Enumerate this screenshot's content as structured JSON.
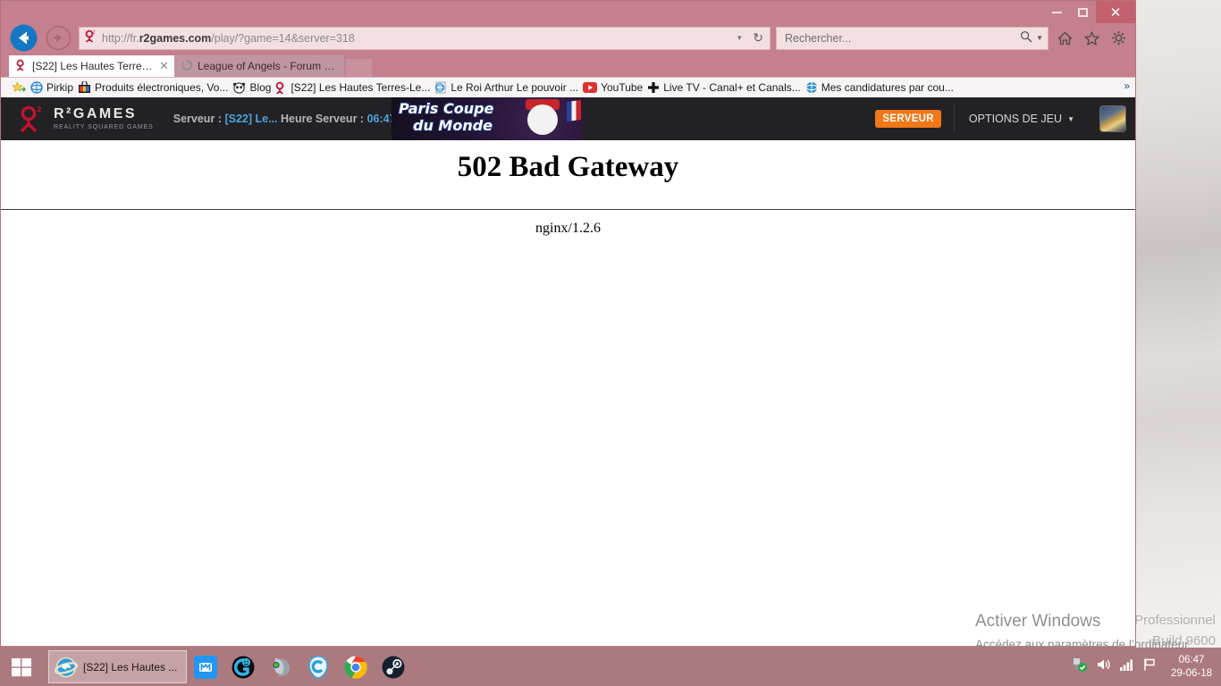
{
  "desktop": {
    "watermark_line1": "Professionnel",
    "watermark_line2": "Build 9600"
  },
  "browser": {
    "window_controls": {
      "minimize": "–",
      "maximize": "□",
      "close": "✕"
    },
    "nav": {
      "back_icon": "back-arrow-icon",
      "forward_icon": "forward-arrow-icon"
    },
    "address": {
      "favicon": "r2games-icon",
      "url_prefix": "http://fr.",
      "url_domain": "r2games.com",
      "url_path": "/play/?game=14&server=318",
      "dropdown_caret": "▼",
      "reload_icon": "↻"
    },
    "search": {
      "placeholder": "Rechercher...",
      "icon": "search-icon",
      "caret": "▼"
    },
    "toolbar_icons": [
      "home-icon",
      "favorites-star-icon",
      "settings-gear-icon"
    ],
    "tabs": [
      {
        "title": "[S22] Les Hautes Terres-Lea...",
        "favicon": "r2games-icon",
        "close": "✕",
        "active": true
      },
      {
        "title": "League of Angels - Forum de R...",
        "favicon": "loading-spinner-icon",
        "active": false
      }
    ],
    "bookmarks": {
      "overflow_chevron": "»",
      "items": [
        {
          "label": "",
          "icon": "favorites-add-icon"
        },
        {
          "label": "Pirkip",
          "icon": "ie-icon"
        },
        {
          "label": "Produits électroniques, Vo...",
          "icon": "shopping-bag-icon"
        },
        {
          "label": "Blog",
          "icon": "panda-icon"
        },
        {
          "label": "[S22] Les Hautes Terres-Le...",
          "icon": "r2games-icon"
        },
        {
          "label": "Le Roi Arthur  Le pouvoir ...",
          "icon": "ie-doc-icon"
        },
        {
          "label": "YouTube",
          "icon": "youtube-icon"
        },
        {
          "label": "Live TV - Canal+ et Canals...",
          "icon": "canalplus-icon"
        },
        {
          "label": "Mes candidatures par cou...",
          "icon": "ie-icon"
        }
      ]
    }
  },
  "game_header": {
    "logo_main": "R²GAMES",
    "logo_sub": "REALITY SQUARED GAMES",
    "server_label": "Serveur :",
    "server_value": "[S22] Le...",
    "time_label": "Heure Serveur :",
    "time_value": "06:47",
    "banner": {
      "line1": "Paris Coupe",
      "line2": "du Monde"
    },
    "serveur_button": "SERVEUR",
    "options_button": "OPTIONS DE JEU",
    "options_caret": "▼",
    "avatar": "player-avatar"
  },
  "error_page": {
    "title": "502 Bad Gateway",
    "server": "nginx/1.2.6"
  },
  "activation": {
    "title": "Activer Windows",
    "body": "Accédez aux paramètres de l’ordinateur pour activer Windows."
  },
  "taskbar": {
    "start": "start-button",
    "ie_task_label": "[S22] Les Hautes ...",
    "apps": [
      "maxthon-icon",
      "cheat-engine-icon",
      "utorrent-icon",
      "ccleaner-icon",
      "chrome-icon",
      "steam-icon"
    ],
    "tray_icons": [
      "safely-remove-hardware-icon",
      "volume-icon",
      "network-signal-icon",
      "action-center-flag-icon"
    ],
    "clock_time": "06:47",
    "clock_date": "29-06-18"
  },
  "colors": {
    "titlebar": "#c4808e",
    "accent_orange": "#f07818",
    "header_dark": "#222225",
    "taskbar": "#ab7a7f",
    "link_blue": "#4ea3d6"
  }
}
